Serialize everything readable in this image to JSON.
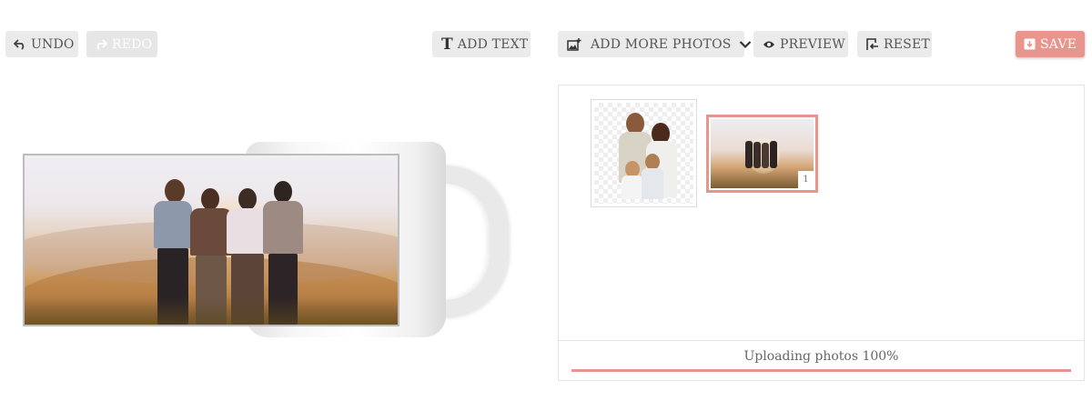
{
  "toolbar": {
    "undo_label": "UNDO",
    "redo_label": "REDO",
    "add_text_label": "ADD TEXT",
    "add_more_photos_label": "ADD MORE PHOTOS",
    "preview_label": "PREVIEW",
    "reset_label": "RESET",
    "save_label": "SAVE"
  },
  "icons": {
    "undo": "undo-arrow-icon",
    "redo": "redo-arrow-icon",
    "add_text": "text-T-icon",
    "add_photos": "add-image-icon",
    "dropdown": "chevron-down-icon",
    "preview": "eye-icon",
    "reset": "reset-icon",
    "save": "save-download-icon"
  },
  "photos": {
    "items": [
      {
        "kind": "family-portrait-transparent",
        "selected": false
      },
      {
        "kind": "sunset-group",
        "selected": true,
        "badge": "1"
      }
    ]
  },
  "upload": {
    "status_text": "Uploading photos 100%",
    "progress": 1.0
  },
  "colors": {
    "accent": "#e8958e",
    "button_bg": "#ebebeb",
    "text": "#555555"
  }
}
